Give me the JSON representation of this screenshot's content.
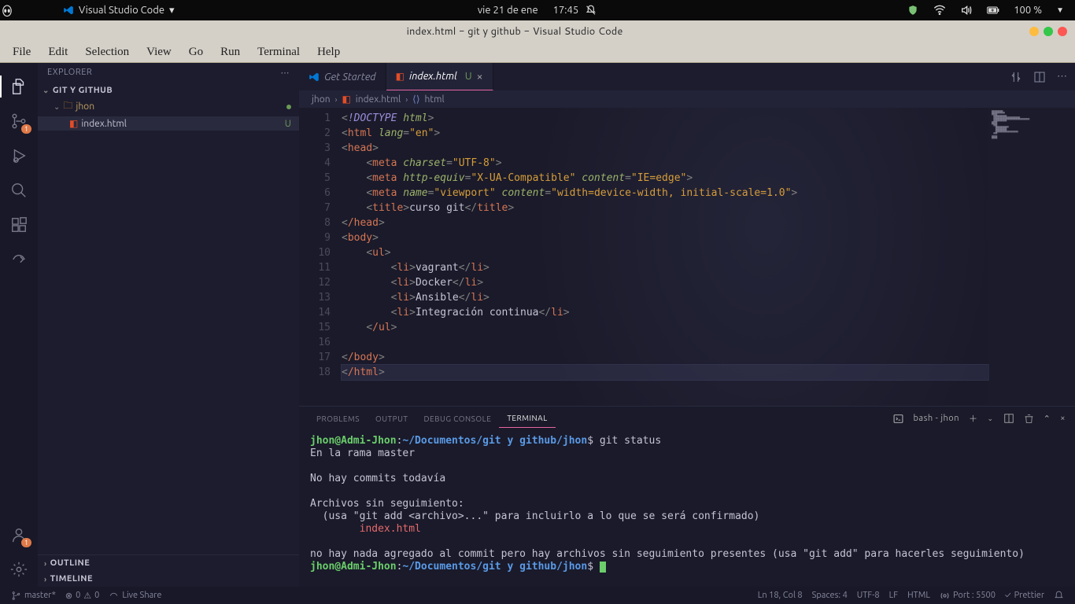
{
  "os_bar": {
    "app_name": "Visual Studio Code",
    "dropdown": "▾",
    "date": "vie 21 de ene",
    "time": "17:45",
    "battery": "100 %"
  },
  "window": {
    "title": "index.html - git y github - Visual Studio Code"
  },
  "menu": {
    "items": [
      "File",
      "Edit",
      "Selection",
      "View",
      "Go",
      "Run",
      "Terminal",
      "Help"
    ]
  },
  "activity_bar": {
    "scm_badge": "1",
    "accounts_badge": "1"
  },
  "sidebar": {
    "header": "EXPLORER",
    "root": "GIT Y GITHUB",
    "folder": "jhon",
    "file": "index.html",
    "file_status": "U",
    "outline": "OUTLINE",
    "timeline": "TIMELINE"
  },
  "tabs": {
    "get_started": "Get Started",
    "file": "index.html",
    "file_status": "U"
  },
  "breadcrumb": {
    "segments": [
      "jhon",
      "index.html",
      "html"
    ]
  },
  "code": {
    "lines": [
      1,
      2,
      3,
      4,
      5,
      6,
      7,
      8,
      9,
      10,
      11,
      12,
      13,
      14,
      15,
      16,
      17,
      18
    ],
    "l1": {
      "doctype": "!DOCTYPE",
      "html": "html"
    },
    "l2": {
      "tag": "html",
      "attr": "lang",
      "val": "\"en\""
    },
    "l3": {
      "tag": "head"
    },
    "l4": {
      "tag": "meta",
      "attr": "charset",
      "val": "\"UTF-8\""
    },
    "l5": {
      "tag": "meta",
      "a1": "http-equiv",
      "v1": "\"X-UA-Compatible\"",
      "a2": "content",
      "v2": "\"IE=edge\""
    },
    "l6": {
      "tag": "meta",
      "a1": "name",
      "v1": "\"viewport\"",
      "a2": "content",
      "v2": "\"width=device-width, initial-scale=1.0\""
    },
    "l7": {
      "tag": "title",
      "txt": "curso git"
    },
    "l8": {
      "tag": "/head"
    },
    "l9": {
      "tag": "body"
    },
    "l10": {
      "tag": "ul"
    },
    "l11": {
      "tag": "li",
      "txt": "vagrant"
    },
    "l12": {
      "tag": "li",
      "txt": "Docker"
    },
    "l13": {
      "tag": "li",
      "txt": "Ansible"
    },
    "l14": {
      "tag": "li",
      "txt": "Integración continua"
    },
    "l15": {
      "tag": "/ul"
    },
    "l17": {
      "tag": "/body"
    },
    "l18": {
      "tag": "/html"
    }
  },
  "panel": {
    "tabs": {
      "problems": "PROBLEMS",
      "output": "OUTPUT",
      "debug": "DEBUG CONSOLE",
      "terminal": "TERMINAL"
    },
    "shell": "bash - jhon"
  },
  "terminal": {
    "user_host": "jhon@Admi-Jhon",
    "path": "~/Documentos/git y github/jhon",
    "prompt_end": "$",
    "cmd": "git status",
    "r1": "En la rama master",
    "r2": "No hay commits todavía",
    "r3": "Archivos sin seguimiento:",
    "r4": "  (usa \"git add <archivo>...\" para incluirlo a lo que se será confirmado)",
    "r5": "        index.html",
    "r6": "no hay nada agregado al commit pero hay archivos sin seguimiento presentes (usa \"git add\" para hacerles seguimiento)"
  },
  "status_bar": {
    "branch": "master*",
    "errors": "0",
    "warnings": "0",
    "live_share": "Live Share",
    "ln_col": "Ln 18, Col 8",
    "spaces": "Spaces: 4",
    "encoding": "UTF-8",
    "eol": "LF",
    "lang": "HTML",
    "port": "Port : 5500",
    "prettier": "Prettier"
  }
}
